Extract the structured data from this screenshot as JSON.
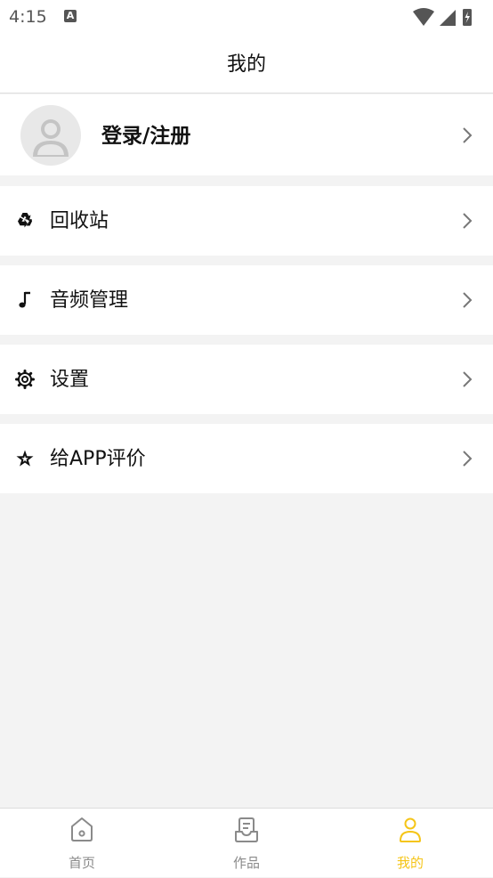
{
  "status_bar": {
    "time": "4:15",
    "notification_icon": "a-icon",
    "icons": [
      "wifi-icon",
      "signal-icon",
      "battery-icon"
    ]
  },
  "header": {
    "title": "我的"
  },
  "profile": {
    "login_label": "登录/注册",
    "avatar_icon": "user-avatar-icon"
  },
  "menu": [
    {
      "label": "回收站",
      "icon": "recycle-icon"
    },
    {
      "label": "音频管理",
      "icon": "music-note-icon"
    },
    {
      "label": "设置",
      "icon": "gear-icon"
    },
    {
      "label": "给APP评价",
      "icon": "star-icon"
    }
  ],
  "bottom_nav": [
    {
      "label": "首页",
      "icon": "home-icon",
      "active": false
    },
    {
      "label": "作品",
      "icon": "works-icon",
      "active": false
    },
    {
      "label": "我的",
      "icon": "person-icon",
      "active": true
    }
  ],
  "colors": {
    "accent": "#f5c518",
    "background": "#f3f3f3",
    "inactive": "#8a8a8a"
  }
}
